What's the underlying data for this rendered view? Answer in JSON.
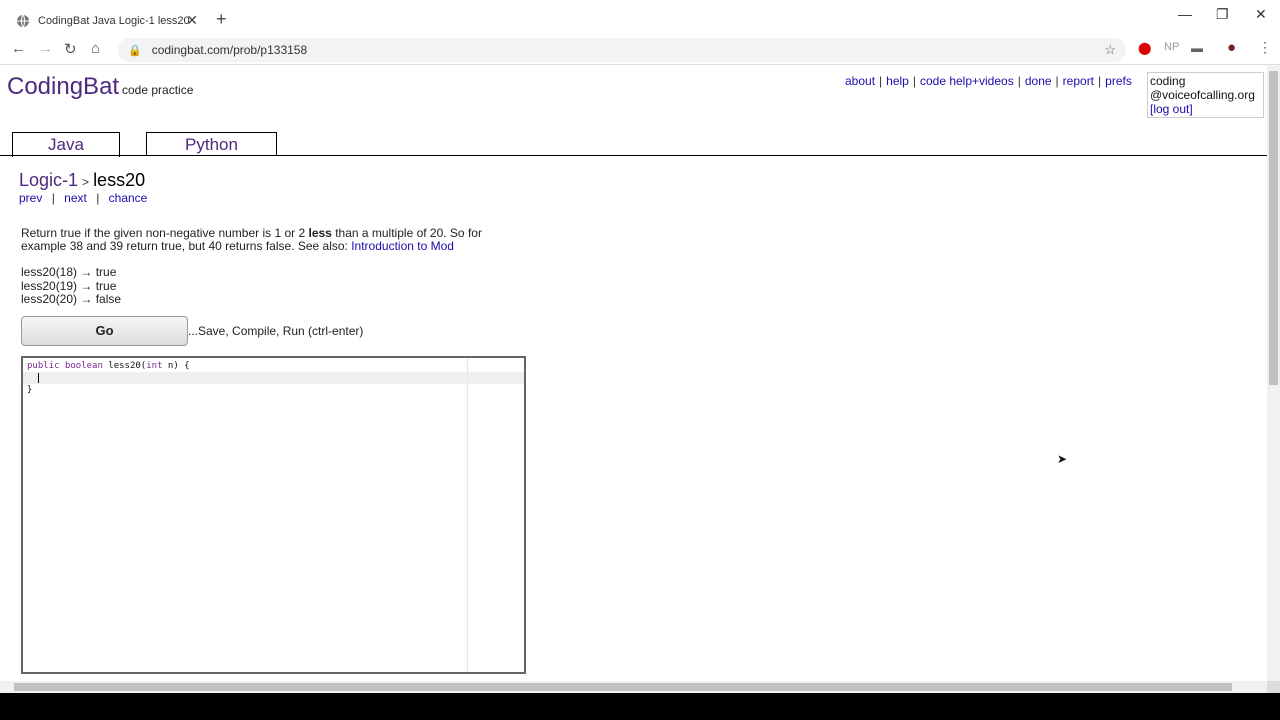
{
  "browser": {
    "tab_title": "CodingBat Java Logic-1 less20",
    "url": "codingbat.com/prob/p133158"
  },
  "site": {
    "logo": "CodingBat",
    "tagline": "code practice",
    "nav": [
      "about",
      "help",
      "code help+videos",
      "done",
      "report",
      "prefs"
    ],
    "user_line1": "coding",
    "user_line2": "@voiceofcalling.org",
    "logout": "[log out]",
    "lang_tabs": [
      "Java",
      "Python"
    ]
  },
  "problem": {
    "section": "Logic-1",
    "name": "less20",
    "nav": [
      "prev",
      "next",
      "chance"
    ],
    "desc_before": "Return true if the given non-negative number is 1 or 2 ",
    "desc_bold": "less",
    "desc_after": " than a multiple of 20. So for example 38 and 39 return true, but 40 returns false. See also: ",
    "desc_link": "Introduction to Mod",
    "examples": [
      "less20(18) → true",
      "less20(19) → true",
      "less20(20) → false"
    ],
    "go_label": "Go",
    "go_hint": "...Save, Compile, Run (ctrl-enter)"
  },
  "editor": {
    "kw1": "public",
    "kw2": "boolean",
    "sig_name": "less20(",
    "kw3": "int",
    "sig_rest": "n) {",
    "line3": "}"
  }
}
